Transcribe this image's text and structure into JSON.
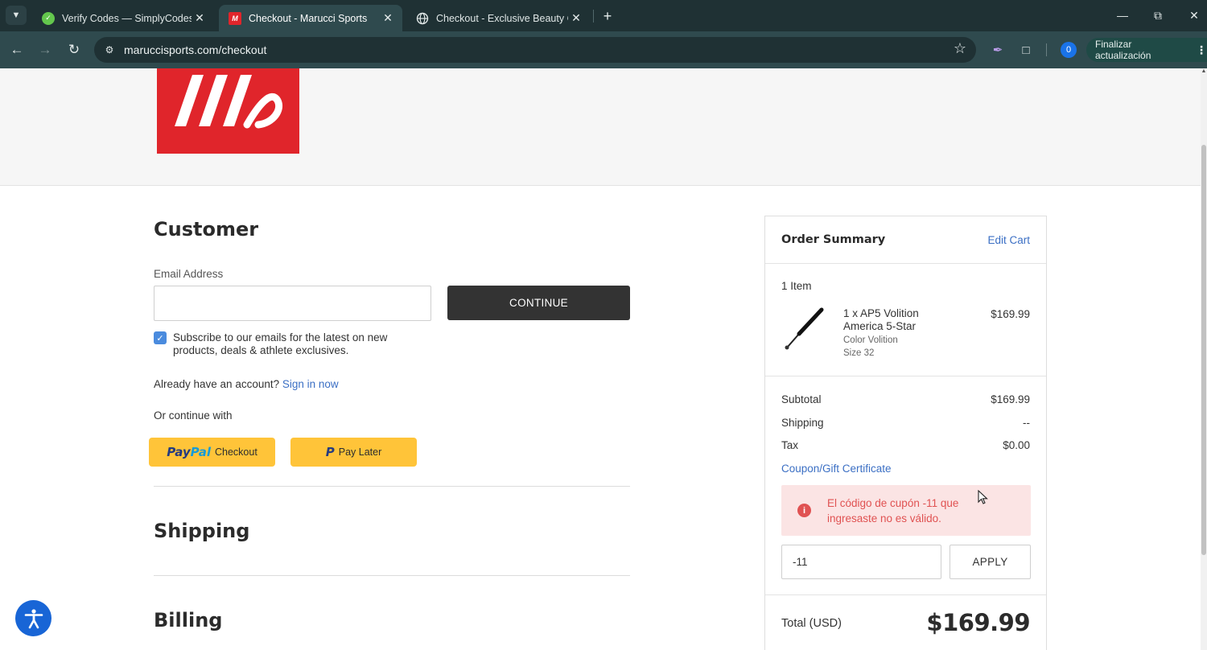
{
  "browser": {
    "tabs": [
      {
        "title": "Verify Codes — SimplyCodes",
        "active": false,
        "favicon": "simplycodes-icon"
      },
      {
        "title": "Checkout - Marucci Sports",
        "active": true,
        "favicon": "marucci-icon"
      },
      {
        "title": "Checkout - Exclusive Beauty Clu",
        "active": false,
        "favicon": "globe-icon"
      }
    ],
    "address": "maruccisports.com/checkout",
    "profile_badge": "0",
    "update_label": "Finalizar actualización"
  },
  "customer": {
    "heading": "Customer",
    "email_label": "Email Address",
    "email_value": "",
    "continue_label": "CONTINUE",
    "subscribe_checked": true,
    "subscribe_text": "Subscribe to our emails for the latest on new products, deals & athlete exclusives.",
    "account_prompt": "Already have an account?",
    "sign_in_label": "Sign in now",
    "or_continue": "Or continue with",
    "paypal_brand_pay": "Pay",
    "paypal_brand_pal": "Pal",
    "paypal_checkout_label": "Checkout",
    "pay_later_label": "Pay Later"
  },
  "shipping": {
    "heading": "Shipping"
  },
  "billing": {
    "heading": "Billing"
  },
  "summary": {
    "title": "Order Summary",
    "edit_cart": "Edit Cart",
    "item_count": "1 Item",
    "item": {
      "name": "1 x AP5 Volition America 5-Star",
      "color": "Color Volition",
      "size": "Size 32",
      "price": "$169.99"
    },
    "subtotal_label": "Subtotal",
    "subtotal_value": "$169.99",
    "shipping_label": "Shipping",
    "shipping_value": "--",
    "tax_label": "Tax",
    "tax_value": "$0.00",
    "coupon_label": "Coupon/Gift Certificate",
    "error_message": "El código de cupón -11 que ingresaste no es válido.",
    "coupon_value": "-11",
    "apply_label": "APPLY",
    "total_label": "Total (USD)",
    "total_value": "$169.99"
  },
  "colors": {
    "brand_red": "#e0252b",
    "paypal_yellow": "#ffc439",
    "link_blue": "#3b6fc4",
    "error_red": "#e05252",
    "error_bg": "#fbe4e4"
  }
}
